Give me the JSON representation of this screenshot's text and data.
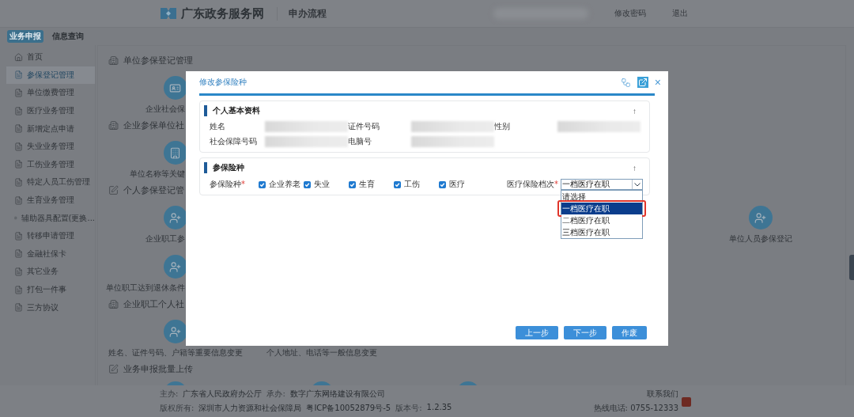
{
  "header": {
    "site_title": "广东政务服务网",
    "section": "申办流程",
    "links": [
      "修改密码",
      "退出"
    ]
  },
  "top_tabs": [
    {
      "label": "业务申报",
      "selected": true
    },
    {
      "label": "信息查询",
      "selected": false
    }
  ],
  "sidebar": {
    "items": [
      {
        "label": "首页",
        "selected": false
      },
      {
        "label": "参保登记管理",
        "selected": true
      },
      {
        "label": "单位缴费管理",
        "selected": false
      },
      {
        "label": "医疗业务管理",
        "selected": false
      },
      {
        "label": "新增定点申请",
        "selected": false
      },
      {
        "label": "失业业务管理",
        "selected": false
      },
      {
        "label": "工伤业务管理",
        "selected": false
      },
      {
        "label": "特定人员工伤管理",
        "selected": false
      },
      {
        "label": "生育业务管理",
        "selected": false
      },
      {
        "label": "辅助器具配置(更换...",
        "selected": false
      },
      {
        "label": "转移申请管理",
        "selected": false
      },
      {
        "label": "金融社保卡",
        "selected": false
      },
      {
        "label": "其它业务",
        "selected": false
      },
      {
        "label": "打包一件事",
        "selected": false
      },
      {
        "label": "三方协议",
        "selected": false
      }
    ]
  },
  "sections": [
    {
      "title": "单位参保登记管理",
      "rows": [
        [
          {
            "kind": "full",
            "label": "企业社会保",
            "cut": true
          }
        ]
      ]
    },
    {
      "title": "企业参保单位社",
      "rows": [
        [
          {
            "kind": "full",
            "label": "单位名称等关键",
            "cut": true
          }
        ]
      ]
    },
    {
      "title": "个人参保登记管",
      "rows": [
        [
          {
            "kind": "full",
            "label": "企业职工参",
            "cut": true
          },
          {
            "kind": "gap"
          },
          {
            "kind": "gap"
          },
          {
            "kind": "gap"
          },
          {
            "kind": "full",
            "label": "单位人员参保登记",
            "cut": false
          }
        ],
        [
          {
            "kind": "full",
            "label": "单位职工达到退休条件",
            "cut": true
          }
        ]
      ]
    },
    {
      "title": "企业职工个人社",
      "rows": [
        [
          {
            "kind": "full",
            "label": "姓名、证件号码、户籍等重要信息变更",
            "cut": false
          },
          {
            "kind": "label-only",
            "label": "个人地址、电话等一般信息变更"
          }
        ]
      ]
    },
    {
      "title": "业务申报批量上传",
      "rows": [
        [
          {
            "kind": "icon-only"
          },
          {
            "kind": "icon-only"
          },
          {
            "kind": "icon-only"
          }
        ]
      ]
    }
  ],
  "footer": {
    "line_1": [
      {
        "label": "主办:",
        "value": "广东省人民政府办公厅"
      },
      {
        "label": "承办:",
        "value": "数字广东网络建设有限公司"
      }
    ],
    "line_2": [
      {
        "label": "版权所有:",
        "value": "深圳市人力资源和社会保障局"
      },
      {
        "value": "粤ICP备10052879号-5"
      },
      {
        "label": "版本号:",
        "value": "1.2.35"
      }
    ],
    "contact": "联系我们",
    "hotline": "热线电话: 0755-12333"
  },
  "dialog": {
    "title": "修改参保险种",
    "basic_info": {
      "title": "个人基本资料",
      "collapse": "↑",
      "fields": [
        {
          "label": "姓名"
        },
        {
          "label": "证件号码"
        },
        {
          "label": "性别"
        },
        {
          "label": "社会保障号码"
        },
        {
          "label": "电脑号"
        }
      ]
    },
    "insurance": {
      "title": "参保险种",
      "collapse": "↑",
      "label": "参保险种",
      "required_mark": "*",
      "types": [
        {
          "label": "企业养老",
          "checked": true
        },
        {
          "label": "失业",
          "checked": true
        },
        {
          "label": "生育",
          "checked": true
        },
        {
          "label": "工伤",
          "checked": true
        },
        {
          "label": "医疗",
          "checked": true
        }
      ],
      "grade": {
        "label": "医疗保险档次",
        "required_mark": "*",
        "value": "一档医疗在职",
        "expanded": true,
        "options": [
          {
            "label": "请选择",
            "selected": false,
            "highlight": false
          },
          {
            "label": "一档医疗在职",
            "selected": true,
            "highlight": true
          },
          {
            "label": "二档医疗在职",
            "selected": false,
            "highlight": false
          },
          {
            "label": "三档医疗在职",
            "selected": false,
            "highlight": false
          }
        ]
      }
    },
    "buttons": [
      "上一步",
      "下一步",
      "作废"
    ],
    "close": "×"
  }
}
